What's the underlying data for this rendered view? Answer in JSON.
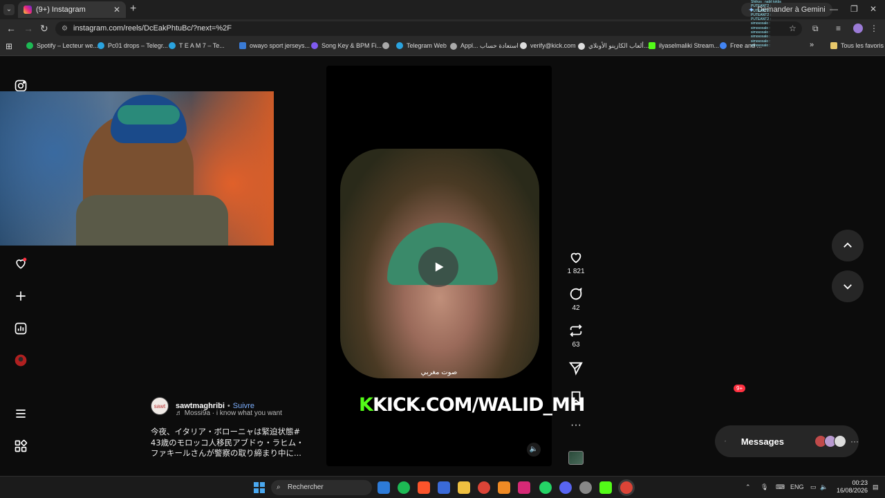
{
  "browser": {
    "tab_title": "(9+) Instagram",
    "new_tab_symbol": "+",
    "gemini_label": "Demander à Gemini",
    "url": "instagram.com/reels/DcEakPhtuBc/?next=%2F",
    "bookmarks": [
      {
        "label": "Spotify – Lecteur we...",
        "color": "#1db954"
      },
      {
        "label": "Pc01 drops – Telegr...",
        "color": "#2aa3df"
      },
      {
        "label": "T E A M 7 – Te...",
        "color": "#2aa3df"
      },
      {
        "label": "owayo sport jerseys...",
        "color": "#3a7bd5"
      },
      {
        "label": "Song Key & BPM Fi...",
        "color": "#7f5af0"
      },
      {
        "label": "Telegram Web",
        "color": "#2aa3df"
      },
      {
        "label": "Appl... استعادة حساب",
        "color": "#aaaaaa"
      },
      {
        "label": "verify@kick.com",
        "color": "#dddddd"
      },
      {
        "label": "ألعاب الكازينو الأونلاي...",
        "color": "#dddddd"
      },
      {
        "label": "ilyaselmaliki Stream...",
        "color": "#53fc18"
      },
      {
        "label": "Free and ...",
        "color": "#4285f4"
      }
    ],
    "bookmarks_more": "»",
    "all_bookmarks": "Tous les favoris"
  },
  "chat_overlay": [
    "Shiikss : nabil tokbsha ghalya",
    "PUTEANT2 :",
    "PUTEANT2 :",
    "PUTEANT2 :",
    "PUTEANT2 :",
    "simosoxalo :",
    "simosoxalo :",
    "simosoxalo :",
    "simosoxalo :",
    "simosoxalo :",
    "simosoxalo :"
  ],
  "reel": {
    "caption_overlay": "صوت مغربي",
    "author": "sawtmaghribi",
    "author_avatar_text": "sawt",
    "separator": "•",
    "follow": "Suivre",
    "audio": "Mossi9a · i know what you want",
    "description": "今夜、イタリア・ボローニャは緊迫状態# 43歳のモロッコ人移民アブドゥ・ラヒム・ファキールさんが警察の取り締まり中に..."
  },
  "actions": {
    "likes": "1 821",
    "comments": "42",
    "reposts": "63"
  },
  "kick_banner": {
    "k": "K",
    "text": "KICK.COM/WALID_MH"
  },
  "messages": {
    "label": "Messages",
    "badge": "9+",
    "more": "···"
  },
  "taskbar": {
    "search_placeholder": "Rechercher",
    "lang": "ENG",
    "time": "00:23",
    "date": "16/08/2026"
  },
  "colors": {
    "accent_link": "#7db0ff",
    "notification": "#ff3040",
    "kick_green": "#53fc18"
  }
}
